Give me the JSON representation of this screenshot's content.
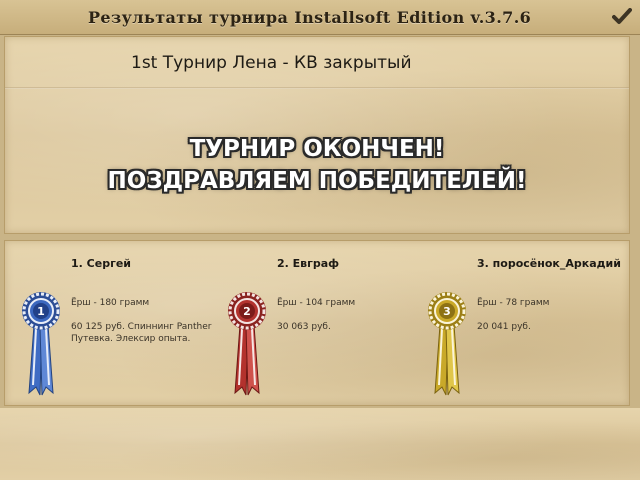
{
  "window": {
    "title": "Результаты турнира  Installsoft Edition v.3.7.6",
    "close_icon": "checkmark-close-icon"
  },
  "tournament": {
    "name": "1st Турнир Лена - КВ закрытый",
    "banner_line1": "ТУРНИР ОКОНЧЕН!",
    "banner_line2": "ПОЗДРАВЛЯЕМ ПОБЕДИТЕЛЕЙ!"
  },
  "winners": [
    {
      "name": "1. Сергей",
      "catch": "Ёрш - 180 грамм",
      "prize": "60 125 руб. Спиннинг Panther Путевка. Элексир опыта.",
      "ribbon_icon": "first-place-ribbon-icon",
      "color": "#3a64b8"
    },
    {
      "name": "2. Евграф",
      "catch": "Ёрш - 104 грамм",
      "prize": "30 063 руб.",
      "ribbon_icon": "second-place-ribbon-icon",
      "color": "#b0302c"
    },
    {
      "name": "3. поросёнок_Аркадий",
      "catch": "Ёрш - 78 грамм",
      "prize": "20 041 руб.",
      "ribbon_icon": "third-place-ribbon-icon",
      "color": "#c9a92a"
    }
  ]
}
